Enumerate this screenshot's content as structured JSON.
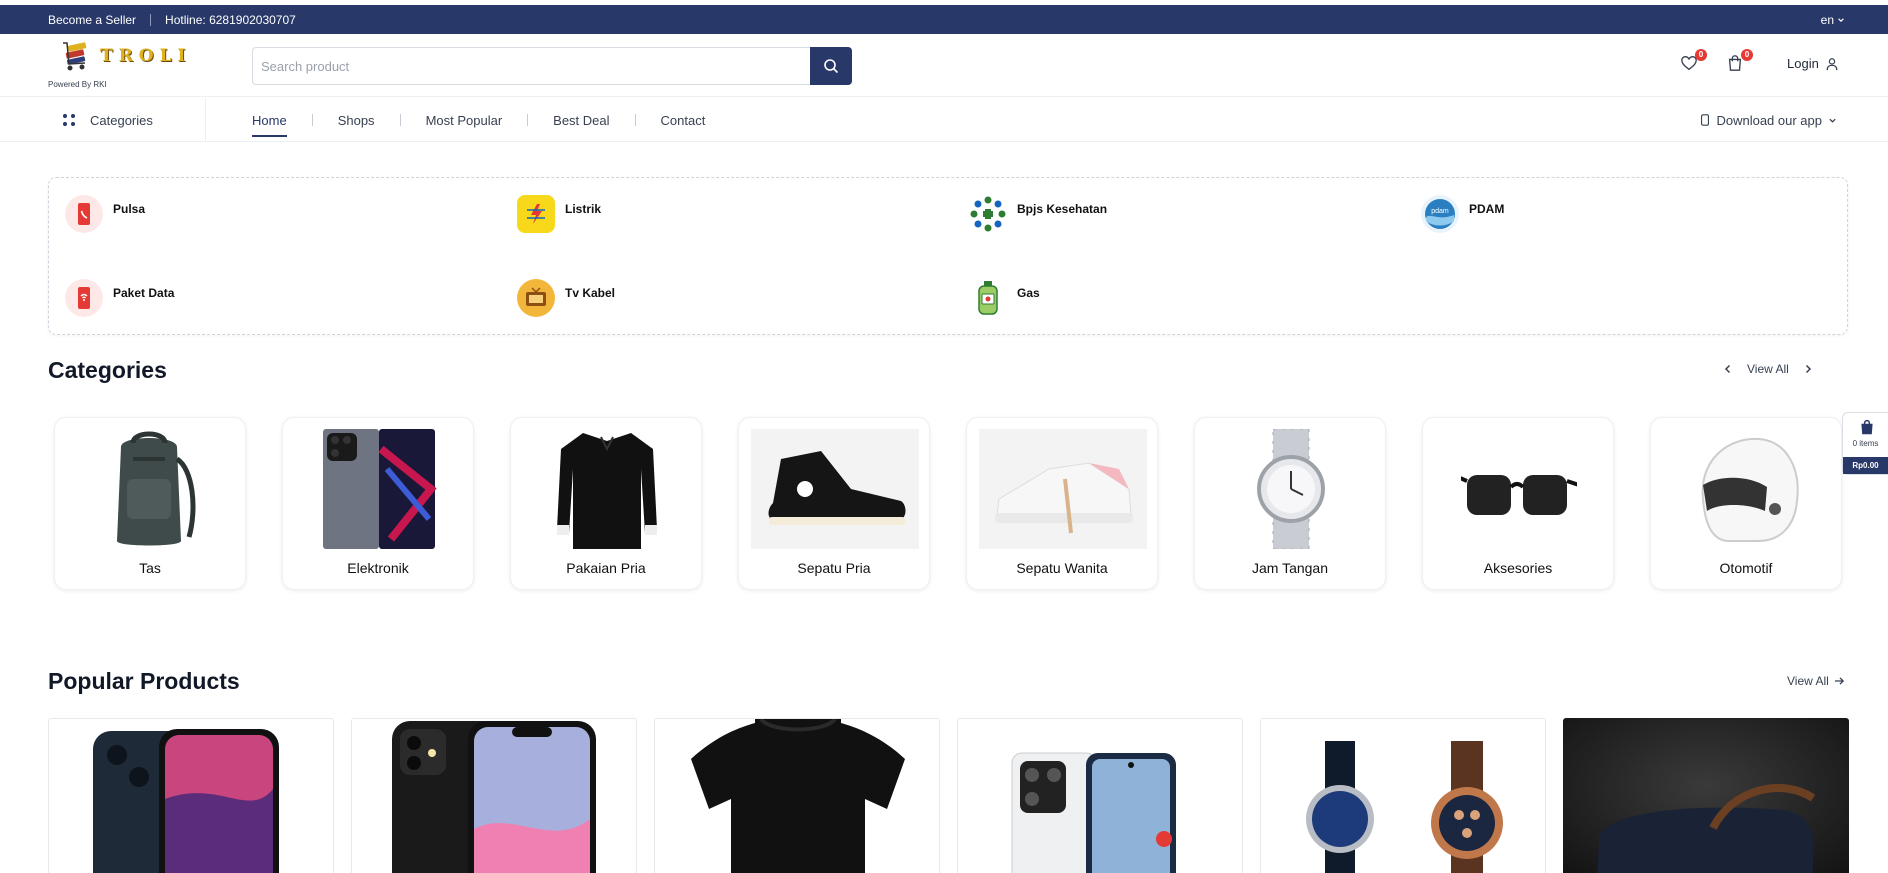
{
  "topbar": {
    "seller_label": "Become a Seller",
    "hotline": "Hotline: 6281902030707",
    "language": "en"
  },
  "header": {
    "logo_text": "TROLI",
    "logo_sub": "Powered By RKI",
    "search_placeholder": "Search product",
    "wishlist_count": "0",
    "cart_count": "0",
    "login_label": "Login"
  },
  "nav": {
    "categories_label": "Categories",
    "links": [
      "Home",
      "Shops",
      "Most Popular",
      "Best Deal",
      "Contact"
    ],
    "active": "Home",
    "download_label": "Download our app"
  },
  "services": [
    {
      "label": "Pulsa",
      "icon": "phone-icon"
    },
    {
      "label": "Listrik",
      "icon": "electricity-icon"
    },
    {
      "label": "Bpjs Kesehatan",
      "icon": "bpjs-icon"
    },
    {
      "label": "PDAM",
      "icon": "pdam-icon"
    },
    {
      "label": "Paket Data",
      "icon": "data-package-icon"
    },
    {
      "label": "Tv Kabel",
      "icon": "tv-icon"
    },
    {
      "label": "Gas",
      "icon": "gas-cylinder-icon"
    }
  ],
  "categories_section": {
    "title": "Categories",
    "view_all": "View All",
    "items": [
      "Tas",
      "Elektronik",
      "Pakaian Pria",
      "Sepatu Pria",
      "Sepatu Wanita",
      "Jam Tangan",
      "Aksesories",
      "Otomotif"
    ]
  },
  "side_cart": {
    "items": "0 items",
    "total": "Rp0.00"
  },
  "popular_section": {
    "title": "Popular Products",
    "view_all": "View All"
  },
  "colors": {
    "primary": "#283869",
    "badge": "#e53935",
    "logo_gold": "#e0b11e"
  }
}
